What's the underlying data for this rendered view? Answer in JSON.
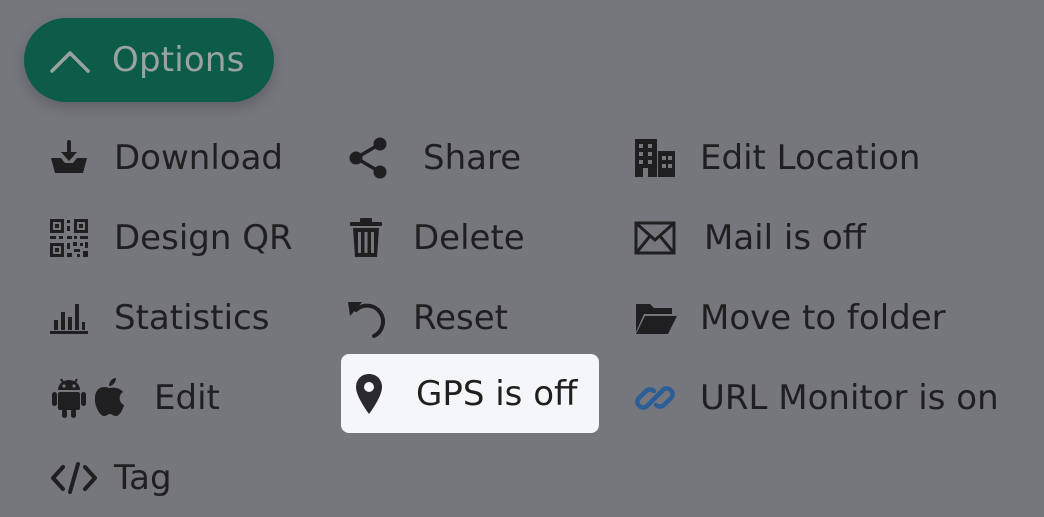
{
  "options_toggle": {
    "label": "Options",
    "chevron_icon": "chevron-up-icon",
    "color": "#0d5c4a"
  },
  "menu": {
    "column1": [
      {
        "label": "Download",
        "icon": "download-tray-icon"
      },
      {
        "label": "Design QR",
        "icon": "qr-code-icon"
      },
      {
        "label": "Statistics",
        "icon": "bar-chart-icon"
      },
      {
        "label": "Edit",
        "icon": "android-apple-icon"
      },
      {
        "label": "Tag",
        "icon": "code-tag-icon"
      }
    ],
    "column2": [
      {
        "label": "Share",
        "icon": "share-icon"
      },
      {
        "label": "Delete",
        "icon": "trash-icon"
      },
      {
        "label": "Reset",
        "icon": "undo-icon"
      },
      {
        "label": "GPS is off",
        "icon": "map-pin-icon",
        "highlighted": true
      }
    ],
    "column3": [
      {
        "label": "Edit Location",
        "icon": "building-icon"
      },
      {
        "label": "Mail is off",
        "icon": "envelope-icon"
      },
      {
        "label": "Move to folder",
        "icon": "folder-open-icon"
      },
      {
        "label": "URL Monitor is on",
        "icon": "link-icon",
        "icon_color": "#2b5d96"
      }
    ]
  },
  "colors": {
    "background": "#76777d",
    "highlight": "#f5f6fa",
    "text": "#1f1f22"
  }
}
